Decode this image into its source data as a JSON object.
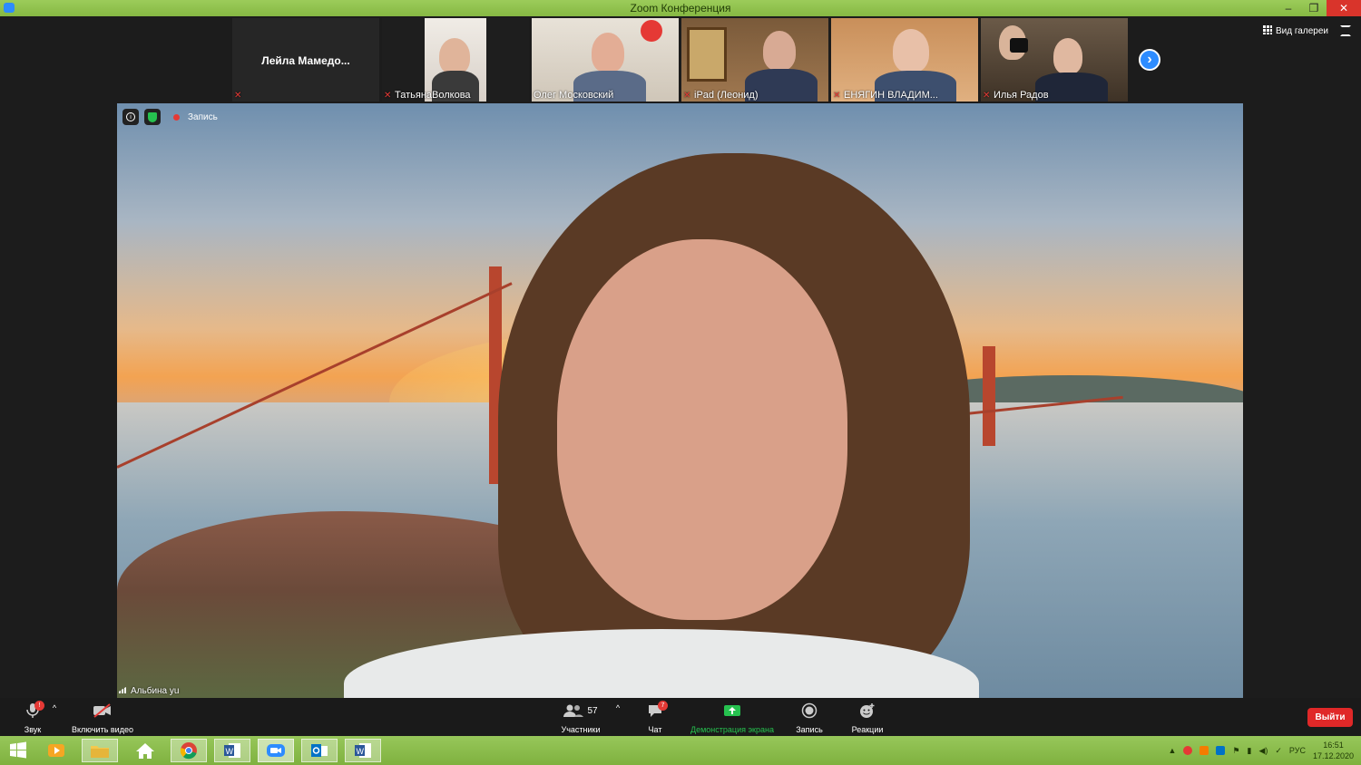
{
  "window": {
    "title": "Zoom Конференция",
    "minimize_glyph": "–",
    "restore_glyph": "❐",
    "close_glyph": "✕"
  },
  "participants": [
    {
      "name": "Лейла  Мамедо...",
      "muted": true,
      "video": false
    },
    {
      "name": "ТатьянаВолкова",
      "muted": true,
      "video": true
    },
    {
      "name": "Олег Московский",
      "muted": false,
      "video": true
    },
    {
      "name": "iPad (Леонид)",
      "muted": true,
      "video": true
    },
    {
      "name": "ЕНЯГИН ВЛАДИМ...",
      "muted": true,
      "video": true
    },
    {
      "name": "Илья Радов",
      "muted": true,
      "video": true
    }
  ],
  "gallery_view_label": "Вид галереи",
  "next_page_glyph": "›",
  "main_video": {
    "speaker_name": "Альбина yu",
    "recording_label": "Запись",
    "info_glyph": "i"
  },
  "toolbar": {
    "audio_label": "Звук",
    "audio_badge": "!",
    "video_label": "Включить видео",
    "participants_label": "Участники",
    "participants_count": "57",
    "chat_label": "Чат",
    "chat_badge": "7",
    "share_label": "Демонстрация экрана",
    "record_label": "Запись",
    "reactions_label": "Реакции",
    "leave_label": "Выйти",
    "caret_glyph": "^"
  },
  "taskbar": {
    "language": "РУС",
    "time": "16:51",
    "date": "17.12.2020"
  },
  "colors": {
    "titlebar": "#8bc34a",
    "accent_blue": "#2d8cff",
    "leave_red": "#e02828",
    "share_green": "#26c14f"
  }
}
